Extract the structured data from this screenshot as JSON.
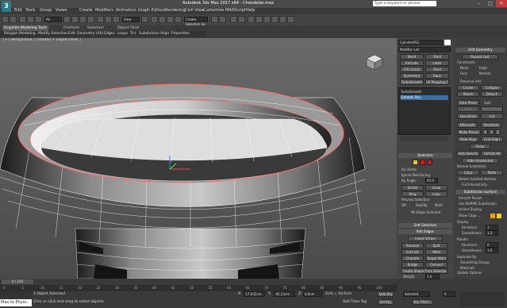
{
  "app": {
    "title": "Autodesk 3ds Max 2017 x64 - Chandelier.max",
    "search_placeholder": "Type a keyword or phrase",
    "logo_letter": "3"
  },
  "menu": [
    "Edit",
    "Tools",
    "Group",
    "Views",
    "Create",
    "Modifiers",
    "Animation",
    "Graph Editors",
    "Rendering",
    "Civil View",
    "Customize",
    "MAXScript",
    "Help"
  ],
  "toolbar": {
    "selection_filter": "All",
    "view_dropdown": "View",
    "named_set": "Create Selection Se"
  },
  "ribbon": {
    "tabs": [
      "Graphite Modeling Tools",
      "Freeform",
      "Selection",
      "Object Paint"
    ],
    "subtabs": [
      "Polygon Modeling",
      "Modify Selection",
      "Edit",
      "Geometry (All)",
      "Edges",
      "Loops",
      "Tris",
      "Subdivision",
      "Align",
      "Properties"
    ]
  },
  "viewport": {
    "label": "[+] [Perspective ] [Shaded + Edged Faces ]"
  },
  "command_panel": {
    "object_name": "Cylinder052",
    "modifier_list": "Modifier List",
    "buttons": [
      [
        "Bend",
        "Shell"
      ],
      [
        "Extrude",
        "Lathe"
      ],
      [
        "FFD 2x2x2",
        "Shell"
      ],
      [
        "Symmetry",
        "Taper"
      ],
      [
        "TurboSmooth",
        "UV Mapping Cle"
      ]
    ],
    "stack": [
      "TurboSmooth",
      "Editable Poly"
    ],
    "selection_header": "Selection",
    "by_vertex": "By Vertex",
    "ignore_backfacing": "Ignore Backfacing",
    "by_angle": "By Angle:",
    "by_angle_value": "45.0",
    "shrink": "Shrink",
    "grow": "Grow",
    "ring": "Ring",
    "loop": "Loop",
    "preview_selection": "Preview Selection",
    "preview_off": "Off",
    "preview_subobj": "SubObj",
    "preview_multi": "Multi",
    "edges_selected": "96 Edges Selected",
    "soft_selection": "Soft Selection",
    "edit_edges": "Edit Edges",
    "insert_vertex": "Insert Vertex",
    "remove": "Remove",
    "split": "Split",
    "extrude": "Extrude",
    "weld": "Weld",
    "chamfer": "Chamfer",
    "target_weld": "Target Weld",
    "bridge": "Bridge",
    "connect": "Connect",
    "create_shape": "Create Shape From Selection",
    "weight_label": "Weight:",
    "weight_value": "1.0",
    "crease_label": "Crease:",
    "crease_value": "0.0"
  },
  "edit_geometry": {
    "header": "Edit Geometry",
    "repeat_last": "Repeat Last",
    "constraints": "Constraints",
    "none": "None",
    "edge": "Edge",
    "face": "Face",
    "normal": "Normal",
    "preserve_uvs": "Preserve UVs",
    "create": "Create",
    "collapse": "Collapse",
    "attach": "Attach",
    "detach": "Detach",
    "slice_plane": "Slice Plane",
    "split": "Split",
    "slice": "Slice",
    "reset_plane": "Reset Plane",
    "quickslice": "QuickSlice",
    "cut": "Cut",
    "msmooth": "MSmooth",
    "tessellate": "Tessellate",
    "make_planar": "Make Planar",
    "x": "X",
    "y": "Y",
    "z": "Z",
    "view_align": "View Align",
    "grid_align": "Grid Align",
    "relax": "Relax",
    "hide_selected": "Hide Selected",
    "unhide_all": "Unhide All",
    "hide_unselected": "Hide Unselected",
    "named_selections": "Named Selections:",
    "copy": "Copy",
    "paste": "Paste",
    "delete_isolated": "Delete Isolated Vertices",
    "full_interactivity": "Full Interactivity",
    "subdivision_surface": "Subdivision Surface",
    "smooth_result": "Smooth Result",
    "use_nurms": "Use NURMS Subdivision",
    "isoline_display": "Isoline Display",
    "show_cage": "Show Cage......",
    "display": "Display",
    "iterations": "Iterations:",
    "iterations_value": "1",
    "smoothness": "Smoothness:",
    "smoothness_value": "1.0",
    "render": "Render",
    "render_iterations_value": "0",
    "render_smoothness_value": "1.0",
    "separate_by": "Separate By",
    "smoothing_groups": "Smoothing Groups",
    "materials": "Materials",
    "update_options": "Update Options",
    "always": "Always",
    "when_rendering": "When Rendering",
    "manually": "Manually"
  },
  "timeline": {
    "frame": "0 / 100",
    "ticks": [
      "0",
      "5",
      "10",
      "15",
      "20",
      "25",
      "30",
      "35",
      "40",
      "45",
      "50",
      "55",
      "60",
      "65",
      "70",
      "75",
      "80",
      "85",
      "90",
      "95",
      "100"
    ]
  },
  "status": {
    "listener": "Max to Physc.",
    "selected": "1 Object Selected",
    "prompt": "Click or click-and-drag to select objects",
    "x_label": "X:",
    "x_value": "-17.032cm",
    "y_label": "Y:",
    "y_value": "-42.23cm",
    "z_label": "Z:",
    "z_value": "0.0cm",
    "grid": "Grid = 10.0cm",
    "add_time_tag": "Add Time Tag",
    "auto_key": "Auto Key",
    "set_key": "Set Key",
    "selected_dd": "Selected",
    "key_filters": "Key Filters...",
    "frame_value": "0"
  }
}
